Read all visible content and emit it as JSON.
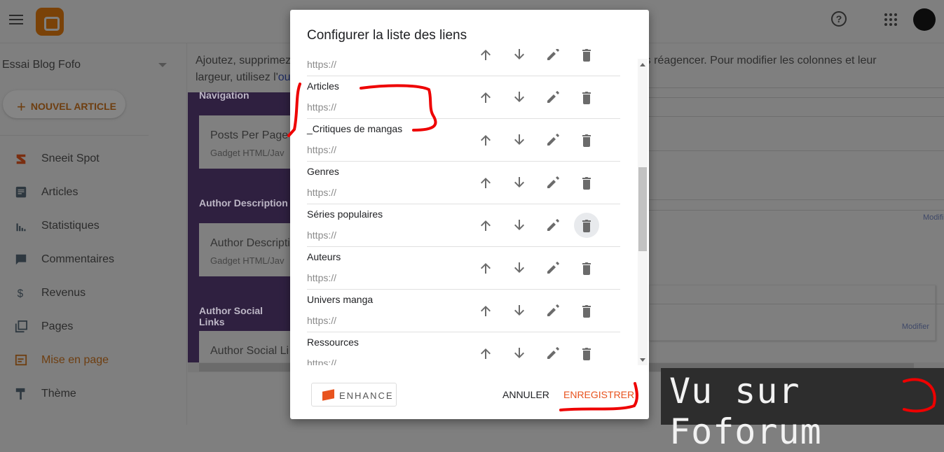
{
  "header": {
    "help_icon": "help-circle-icon",
    "apps_icon": "apps-grid-icon"
  },
  "sidebar": {
    "blog_name": "Essai Blog Fofo",
    "new_post": "NOUVEL ARTICLE",
    "items": [
      {
        "label": "Sneeit Spot",
        "icon": "sneeit-icon"
      },
      {
        "label": "Articles",
        "icon": "article-icon"
      },
      {
        "label": "Statistiques",
        "icon": "stats-icon"
      },
      {
        "label": "Commentaires",
        "icon": "comment-icon"
      },
      {
        "label": "Revenus",
        "icon": "dollar-icon"
      },
      {
        "label": "Pages",
        "icon": "pages-icon"
      },
      {
        "label": "Mise en page",
        "icon": "layout-icon",
        "active": true
      },
      {
        "label": "Thème",
        "icon": "paint-roller-icon"
      }
    ]
  },
  "main": {
    "hint_a": "Ajoutez, supprimez",
    "hint_b": "ser pour les réagencer. Pour modifier les colonnes et leur",
    "hint_c": "largeur, utilisez l'",
    "hint_link": "ou",
    "sections": [
      {
        "title": "Navigation",
        "gadget": "Posts Per Page",
        "type": "Gadget HTML/Jav"
      },
      {
        "title": "Author Description",
        "gadget": "Author Descripti",
        "type": "Gadget HTML/Jav"
      },
      {
        "title": "Author Social Links",
        "gadget": "Author Social Li",
        "type": ""
      }
    ],
    "modify_1": "Modifi",
    "modify_2": "Modifier"
  },
  "dialog": {
    "title": "Configurer la liste des liens",
    "url_placeholder": "https://",
    "links": [
      {
        "name": "",
        "url": "https://"
      },
      {
        "name": "Articles",
        "url": "https://"
      },
      {
        "name": "_Critiques de mangas",
        "url": "https://"
      },
      {
        "name": "Genres",
        "url": "https://"
      },
      {
        "name": "Séries populaires",
        "url": "https://"
      },
      {
        "name": "Auteurs",
        "url": "https://"
      },
      {
        "name": "Univers manga",
        "url": "https://"
      },
      {
        "name": "Ressources",
        "url": "https://"
      }
    ],
    "enhance": "ENHANCE",
    "cancel": "ANNULER",
    "save": "ENREGISTRER",
    "accent": "#e8531e"
  },
  "watermark": "Vu sur Foforum"
}
